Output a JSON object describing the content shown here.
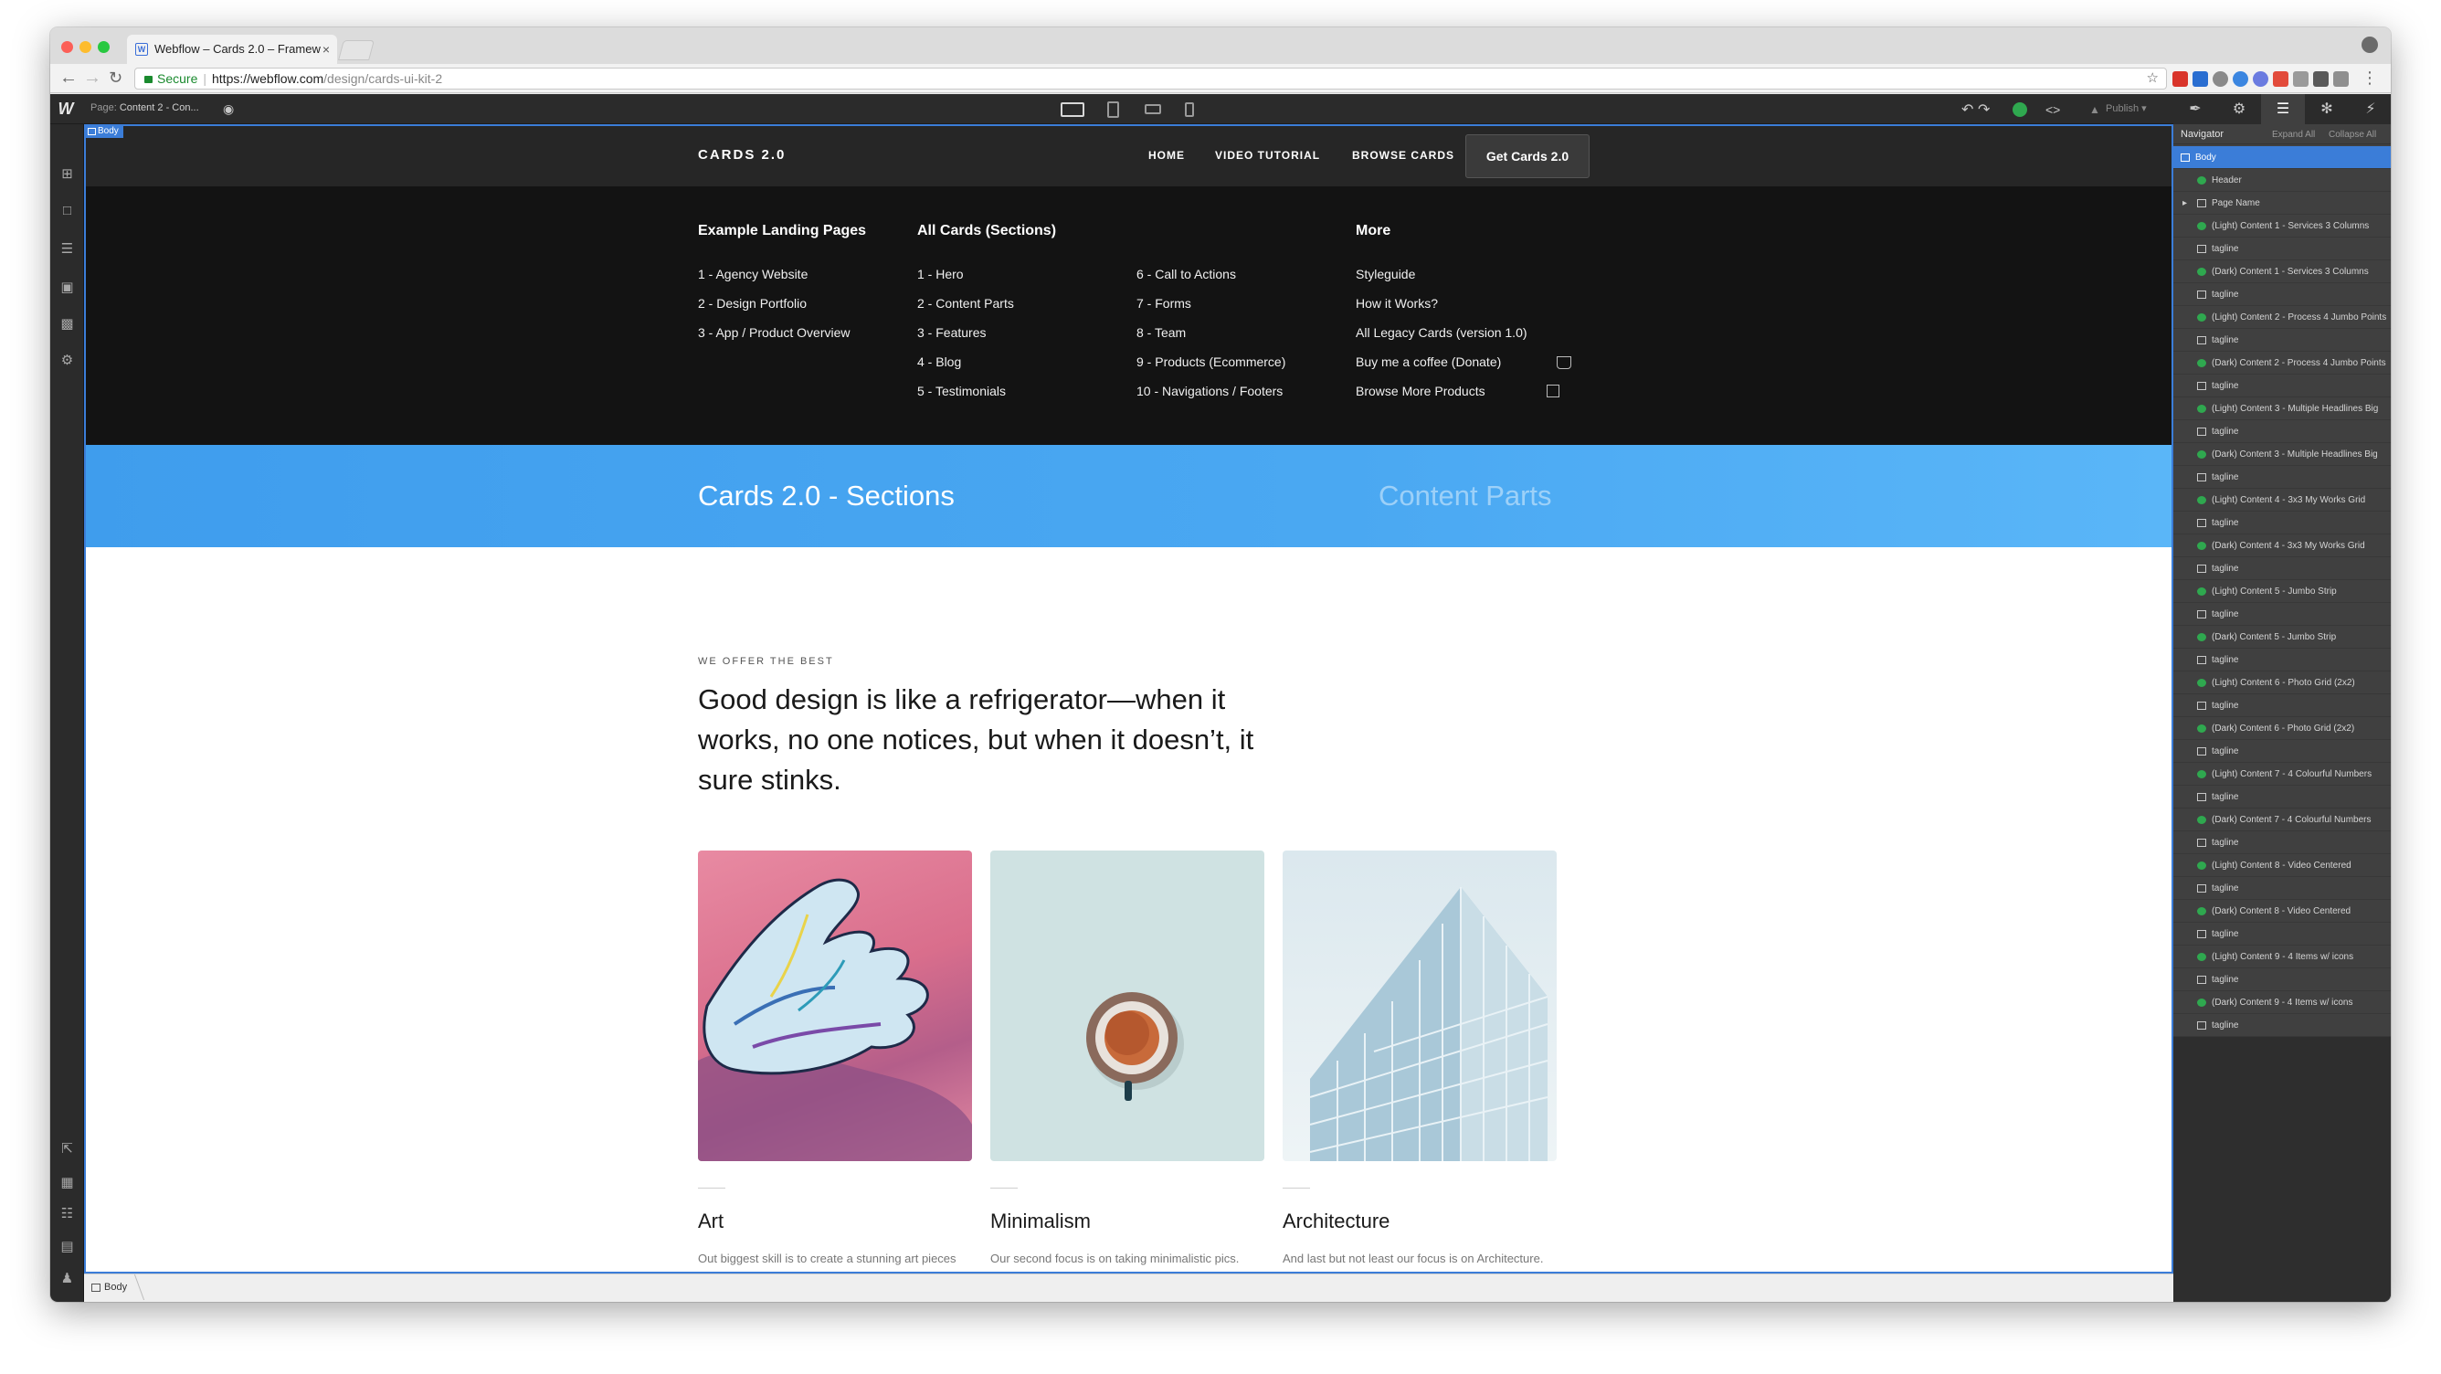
{
  "browser": {
    "tab_title": "Webflow – Cards 2.0 – Framew",
    "tab_favicon": "W",
    "tab_close": "×",
    "address": {
      "secure_label": "Secure",
      "host": "https://webflow.com",
      "path": "/design/cards-ui-kit-2"
    }
  },
  "designer": {
    "logo": "W",
    "page_label": "Page:",
    "page_name": "Content 2 - Con...",
    "publish_label": "Publish",
    "body_badge": "Body",
    "breadcrumb": "Body"
  },
  "navigator": {
    "title": "Navigator",
    "expand_all": "Expand All",
    "collapse_all": "Collapse All",
    "items": [
      {
        "label": "Body",
        "icon": "box",
        "indent": 0,
        "selected": true
      },
      {
        "label": "Header",
        "icon": "symbol",
        "indent": 1
      },
      {
        "label": "Page Name",
        "icon": "box",
        "indent": 1,
        "caret": true
      },
      {
        "label": "(Light) Content 1 - Services 3 Columns",
        "icon": "symbol",
        "indent": 1
      },
      {
        "label": "tagline",
        "icon": "text",
        "indent": 1
      },
      {
        "label": "(Dark) Content 1 - Services 3 Columns",
        "icon": "symbol",
        "indent": 1
      },
      {
        "label": "tagline",
        "icon": "text",
        "indent": 1
      },
      {
        "label": "(Light) Content 2 - Process 4 Jumbo Points",
        "icon": "symbol",
        "indent": 1
      },
      {
        "label": "tagline",
        "icon": "text",
        "indent": 1
      },
      {
        "label": "(Dark) Content 2 - Process 4 Jumbo Points",
        "icon": "symbol",
        "indent": 1
      },
      {
        "label": "tagline",
        "icon": "text",
        "indent": 1
      },
      {
        "label": "(Light) Content 3 - Multiple Headlines Big",
        "icon": "symbol",
        "indent": 1
      },
      {
        "label": "tagline",
        "icon": "text",
        "indent": 1
      },
      {
        "label": "(Dark) Content 3 - Multiple Headlines Big",
        "icon": "symbol",
        "indent": 1
      },
      {
        "label": "tagline",
        "icon": "text",
        "indent": 1
      },
      {
        "label": "(Light) Content 4 - 3x3 My Works Grid",
        "icon": "symbol",
        "indent": 1
      },
      {
        "label": "tagline",
        "icon": "text",
        "indent": 1
      },
      {
        "label": "(Dark) Content 4 - 3x3 My Works Grid",
        "icon": "symbol",
        "indent": 1
      },
      {
        "label": "tagline",
        "icon": "text",
        "indent": 1
      },
      {
        "label": "(Light) Content 5 - Jumbo Strip",
        "icon": "symbol",
        "indent": 1
      },
      {
        "label": "tagline",
        "icon": "text",
        "indent": 1
      },
      {
        "label": "(Dark) Content 5 - Jumbo Strip",
        "icon": "symbol",
        "indent": 1
      },
      {
        "label": "tagline",
        "icon": "text",
        "indent": 1
      },
      {
        "label": "(Light) Content 6 - Photo Grid (2x2)",
        "icon": "symbol",
        "indent": 1
      },
      {
        "label": "tagline",
        "icon": "text",
        "indent": 1
      },
      {
        "label": "(Dark) Content 6 - Photo Grid (2x2)",
        "icon": "symbol",
        "indent": 1
      },
      {
        "label": "tagline",
        "icon": "text",
        "indent": 1
      },
      {
        "label": "(Light) Content 7 - 4 Colourful Numbers",
        "icon": "symbol",
        "indent": 1
      },
      {
        "label": "tagline",
        "icon": "text",
        "indent": 1
      },
      {
        "label": "(Dark) Content 7 - 4 Colourful Numbers",
        "icon": "symbol",
        "indent": 1
      },
      {
        "label": "tagline",
        "icon": "text",
        "indent": 1
      },
      {
        "label": "(Light) Content 8 - Video Centered",
        "icon": "symbol",
        "indent": 1
      },
      {
        "label": "tagline",
        "icon": "text",
        "indent": 1
      },
      {
        "label": "(Dark) Content 8 - Video Centered",
        "icon": "symbol",
        "indent": 1
      },
      {
        "label": "tagline",
        "icon": "text",
        "indent": 1
      },
      {
        "label": "(Light) Content 9 - 4 Items w/ icons",
        "icon": "symbol",
        "indent": 1
      },
      {
        "label": "tagline",
        "icon": "text",
        "indent": 1
      },
      {
        "label": "(Dark) Content 9 - 4 Items w/ icons",
        "icon": "symbol",
        "indent": 1
      },
      {
        "label": "tagline",
        "icon": "text",
        "indent": 1
      }
    ]
  },
  "site": {
    "brand": "CARDS 2.0",
    "nav": {
      "home": "HOME",
      "video": "VIDEO TUTORIAL",
      "browse": "BROWSE CARDS",
      "cta": "Get Cards 2.0"
    },
    "mega": {
      "col1": {
        "heading": "Example Landing Pages",
        "links": [
          "1 - Agency Website",
          "2 - Design Portfolio",
          "3 - App / Product Overview"
        ]
      },
      "col2": {
        "heading": "All Cards (Sections)",
        "links": [
          "1 - Hero",
          "2 - Content Parts",
          "3 - Features",
          "4 - Blog",
          "5 - Testimonials"
        ]
      },
      "col3": {
        "links": [
          "6 - Call to Actions",
          "7 - Forms",
          "8 - Team",
          "9 - Products (Ecommerce)",
          "10 - Navigations / Footers"
        ]
      },
      "col4": {
        "heading": "More",
        "links": [
          "Styleguide",
          "How it Works?",
          "All Legacy Cards (version 1.0)",
          "Buy me a coffee (Donate)",
          "Browse More Products"
        ]
      }
    },
    "hero": {
      "title": "Cards 2.0 - Sections",
      "subtitle": "Content Parts"
    },
    "overline": "WE OFFER THE BEST",
    "headline": "Good design is like a refrigerator—when it works, no one notices, but when it doesn’t, it sure stinks.",
    "cards": [
      {
        "title": "Art",
        "text": "Out biggest skill is to create a stunning art pieces and integrate them into your projects and social media posts."
      },
      {
        "title": "Minimalism",
        "text": "Our second focus is on taking minimalistic pics. We've a team of skilled people who can take a pic of coffee."
      },
      {
        "title": "Architecture",
        "text": "And last but not least our focus is on Architecture. Obviously code architecture. We can create the best, dive."
      }
    ]
  }
}
